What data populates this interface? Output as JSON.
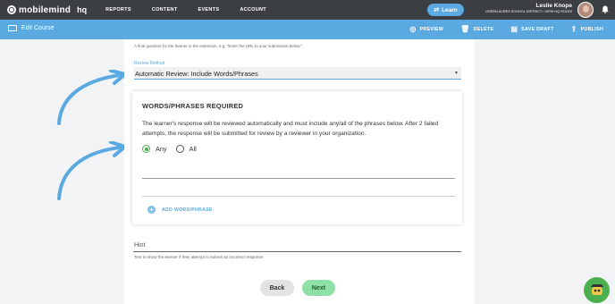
{
  "topbar": {
    "logo_text": "mobilemind",
    "logo_hq": "hq",
    "nav": [
      "REPORTS",
      "CONTENT",
      "EVENTS",
      "ACCOUNT"
    ],
    "learn_button": "Learn",
    "user_name": "Leslie Knope",
    "user_org": "GREEN ACRES SCHOOL DISTRICT • VIEW HQ ROLES"
  },
  "subbar": {
    "title": "Edit Course",
    "actions": [
      "PREVIEW",
      "DELETE",
      "SAVE DRAFT",
      "PUBLISH"
    ]
  },
  "form": {
    "intro_hint": "A final question for the learner in the extension, e.g. \"Enter the URL to your submission below.\"",
    "review_method_label": "Review Method",
    "review_method_value": "Automatic Review: Include Words/Phrases",
    "card_title": "WORDS/PHRASES REQUIRED",
    "card_description": "The learner's response will be reviewed automatically and must include any/all of the phrases below. After 2 failed attempts, the response will be submitted for review by a reviewer in your organization.",
    "radio_any": "Any",
    "radio_all": "All",
    "selected_option": "Any",
    "add_label": "ADD WORD/PHRASE",
    "hint_placeholder": "Hint",
    "hint_help": "Text to show the learner if they attempt to submit an incorrect response.",
    "back_label": "Back",
    "next_label": "Next"
  },
  "colors": {
    "topbar": "#3b3f44",
    "accent": "#5aa9e0",
    "success": "#4caf50",
    "next_button": "#8fe0a6"
  }
}
